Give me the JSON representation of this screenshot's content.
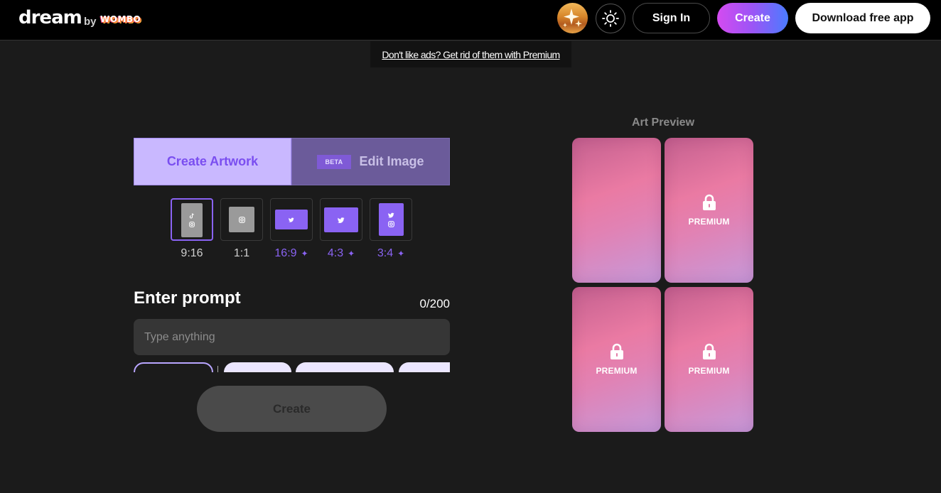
{
  "header": {
    "logo": "dream",
    "by": "by",
    "brand": "WOMBO",
    "sign_in": "Sign In",
    "create": "Create",
    "download": "Download free app"
  },
  "ad_banner": {
    "text": "Don't like ads? Get rid of them with Premium"
  },
  "mode_tabs": {
    "create_artwork": "Create Artwork",
    "beta_badge": "BETA",
    "edit_image": "Edit Image"
  },
  "aspect_ratios": [
    {
      "label": "9:16",
      "premium": false,
      "selected": true
    },
    {
      "label": "1:1",
      "premium": false,
      "selected": false
    },
    {
      "label": "16:9",
      "premium": true,
      "selected": false
    },
    {
      "label": "4:3",
      "premium": true,
      "selected": false
    },
    {
      "label": "3:4",
      "premium": true,
      "selected": false
    }
  ],
  "prompt": {
    "title": "Enter prompt",
    "char_count": "0/200",
    "placeholder": "Type anything",
    "value": ""
  },
  "create_button": "Create",
  "preview": {
    "title": "Art Preview",
    "cards": [
      {
        "locked": false,
        "label": ""
      },
      {
        "locked": true,
        "label": "PREMIUM"
      },
      {
        "locked": true,
        "label": "PREMIUM"
      },
      {
        "locked": true,
        "label": "PREMIUM"
      }
    ]
  },
  "colors": {
    "accent": "#8a63f3",
    "tab_active_bg": "#c9b8ff",
    "tab_inactive_bg": "#6b5b9a",
    "background": "#1b1b1b",
    "topbar": "#000000"
  },
  "icons": [
    "sun-icon",
    "tiktok-icon",
    "instagram-icon",
    "twitter-icon",
    "lock-icon",
    "sparkle-icon"
  ]
}
